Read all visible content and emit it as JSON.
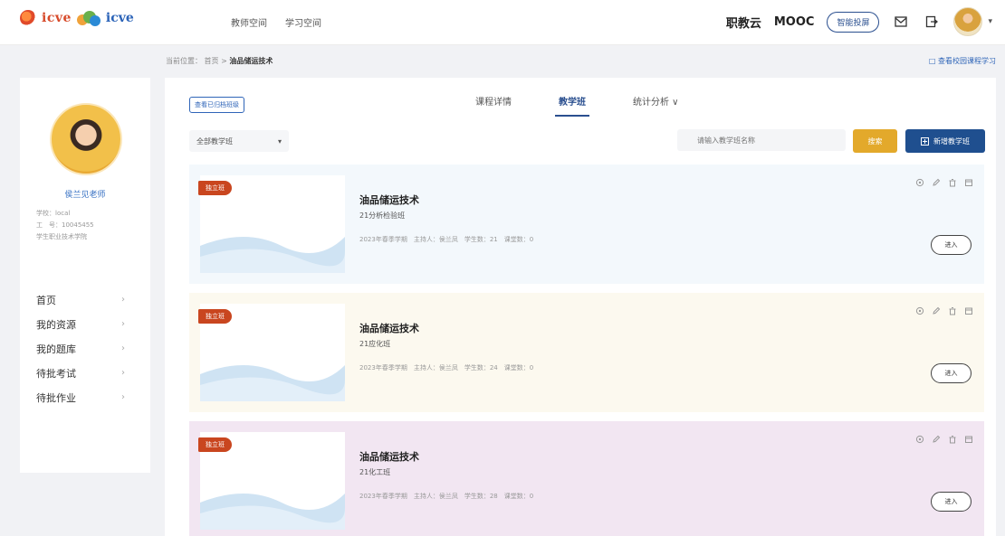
{
  "header": {
    "nav": [
      "教师空间",
      "学习空间"
    ],
    "brand_links": [
      "职教云",
      "MOOC"
    ],
    "pill_button": "智能投屏"
  },
  "breadcrumb": {
    "prefix": "当前位置： 首页 >",
    "current": "油品储运技术",
    "right_link": "□ 查看校园课程学习"
  },
  "profile": {
    "name": "侯兰见老师",
    "info_lines": [
      "学校：local",
      "工　号：10045455",
      "学生职业技术学院"
    ]
  },
  "sidebar": {
    "items": [
      {
        "label": "首页"
      },
      {
        "label": "我的资源"
      },
      {
        "label": "我的题库"
      },
      {
        "label": "待批考试"
      },
      {
        "label": "待批作业"
      }
    ]
  },
  "main": {
    "tag_button": "查看已归档班级",
    "tabs": [
      {
        "label": "课程详情",
        "active": false
      },
      {
        "label": "教学班",
        "active": true
      },
      {
        "label": "统计分析 ∨",
        "active": false
      }
    ],
    "filter_select": "全部教学班",
    "search_placeholder": "请输入教学班名称",
    "search_button": "搜索",
    "new_button": "新增教学班"
  },
  "cards": [
    {
      "badge": "独立班",
      "title": "油品储运技术",
      "class_name": "21分析检验班",
      "meta": "2023年春季学期　主持人：侯兰凤　学生数：21　课堂数：0",
      "enter_label": "进入",
      "bg": "#f3f8fc"
    },
    {
      "badge": "独立班",
      "title": "油品储运技术",
      "class_name": "21应化班",
      "meta": "2023年春季学期　主持人：侯兰凤　学生数：24　课堂数：0",
      "enter_label": "进入",
      "bg": "#fcf9ef"
    },
    {
      "badge": "独立班",
      "title": "油品储运技术",
      "class_name": "21化工班",
      "meta": "2023年春季学期　主持人：侯兰凤　学生数：28　课堂数：0",
      "enter_label": "进入",
      "bg": "#f2e6f2"
    }
  ],
  "colors": {
    "primary": "#1f4f8f",
    "accent_yellow": "#e3a92b",
    "badge_red": "#c9461f"
  }
}
